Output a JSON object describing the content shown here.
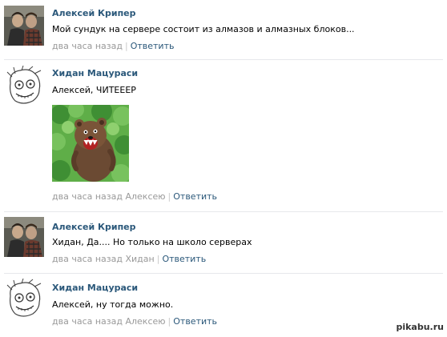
{
  "comments": [
    {
      "author": "Алексей Крипер",
      "text": "Мой сундук на сервере состоит из алмазов и алмазных блоков...",
      "time": "два часа назад",
      "reply_to": "",
      "separator": "|",
      "reply_label": "Ответить"
    },
    {
      "author": "Хидан Мацураси",
      "text": "Алексей, ЧИТЕЕЕР",
      "time": "два часа назад",
      "reply_to": "Алексею",
      "separator": "|",
      "reply_label": "Ответить"
    },
    {
      "author": "Алексей Крипер",
      "text": "Хидан, Да.... Но только на школо серверах",
      "time": "два часа назад",
      "reply_to": "Хидан",
      "separator": "|",
      "reply_label": "Ответить"
    },
    {
      "author": "Хидан Мацураси",
      "text": "Алексей, ну тогда можно.",
      "time": "два часа назад",
      "reply_to": "Алексею",
      "separator": "|",
      "reply_label": "Ответить"
    }
  ],
  "watermark": "pikabu.ru",
  "colors": {
    "link": "#2b587a",
    "meta": "#999999",
    "divider": "#e7e8ec"
  }
}
